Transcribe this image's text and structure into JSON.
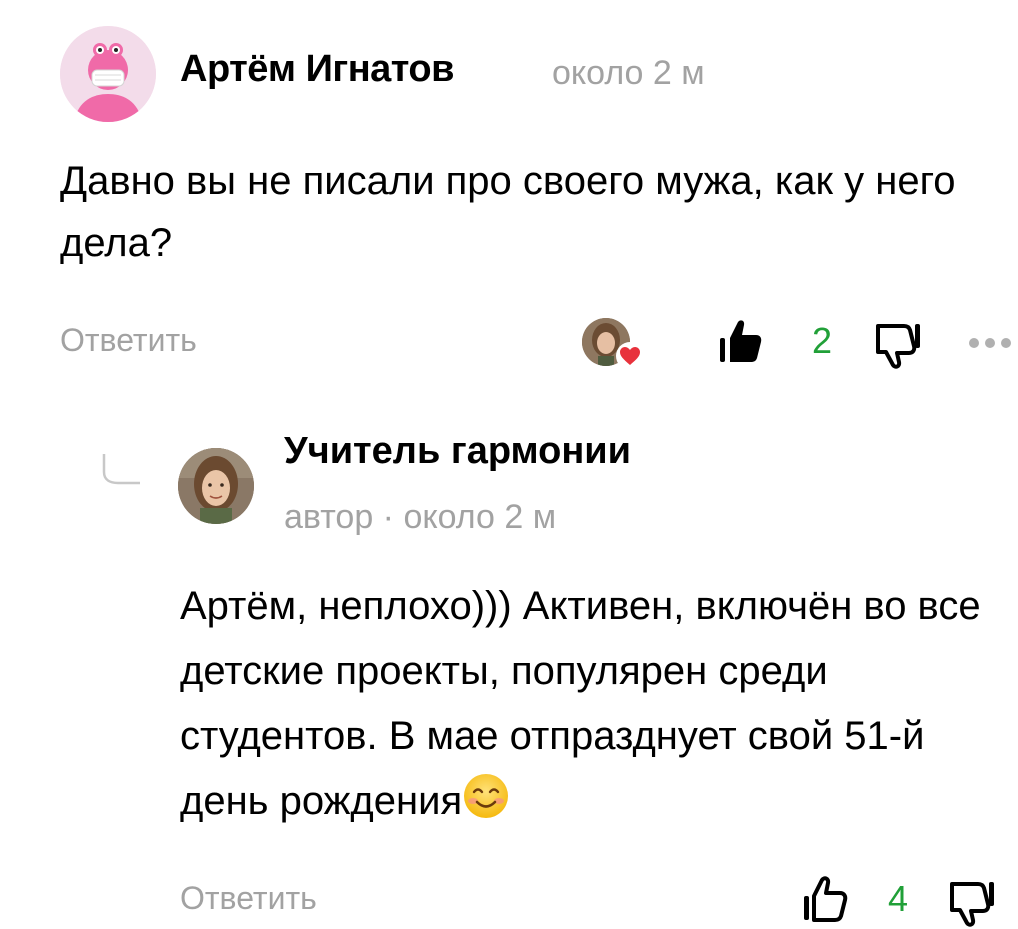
{
  "comments": [
    {
      "author": "Артём Игнатов",
      "time": "около 2 м",
      "text": "Давно вы не писали про своего мужа, как у него дела?",
      "reply_label": "Ответить",
      "likes": "2",
      "avatar_icon": "pink-character-with-mask-icon"
    }
  ],
  "replies": [
    {
      "author": "Учитель гармонии",
      "meta": "автор · около 2 м",
      "text": "Артём, неплохо))) Активен, включён во все детские проекты, популярен среди студентов. В мае отпразднует свой 51-й день рождения",
      "emoji": "smiling-face-emoji",
      "reply_label": "Ответить",
      "likes": "4"
    }
  ],
  "colors": {
    "accent_green": "#21a038",
    "muted_gray": "#a2a2a2",
    "heart_red": "#e8323c",
    "avatar_pink": "#f06aa8"
  }
}
